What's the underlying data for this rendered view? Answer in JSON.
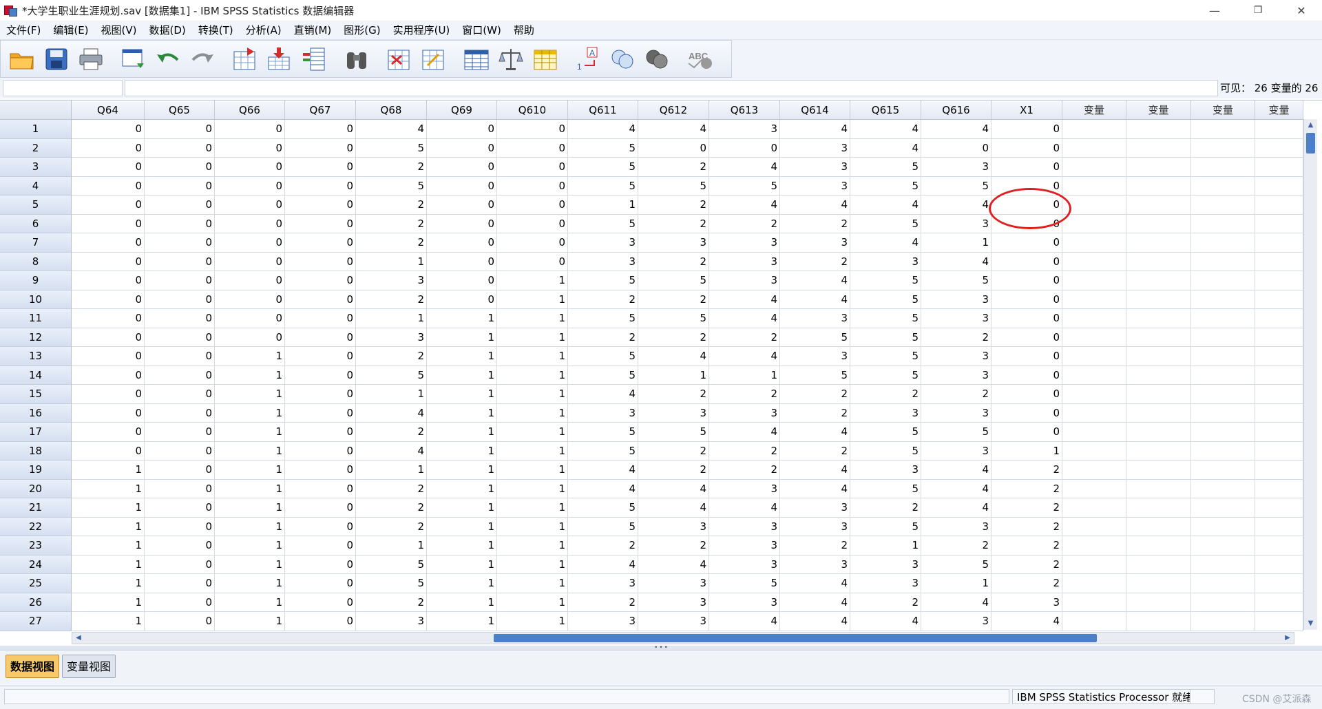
{
  "window": {
    "title": "*大学生职业生涯规划.sav [数据集1] - IBM SPSS Statistics 数据编辑器",
    "minimize": "—",
    "restore": "❐",
    "close": "✕"
  },
  "menu": [
    "文件(F)",
    "编辑(E)",
    "视图(V)",
    "数据(D)",
    "转换(T)",
    "分析(A)",
    "直销(M)",
    "图形(G)",
    "实用程序(U)",
    "窗口(W)",
    "帮助"
  ],
  "toolbar": {
    "icons": [
      "open-folder-icon",
      "save-icon",
      "print-icon",
      "dialog-recall-icon",
      "undo-icon",
      "redo-icon",
      "goto-case-icon",
      "goto-variable-icon",
      "variables-icon",
      "find-icon",
      "insert-cases-icon",
      "insert-variable-icon",
      "split-file-icon",
      "weight-cases-icon",
      "select-cases-icon",
      "value-labels-icon",
      "use-variable-sets-icon",
      "show-all-variables-icon",
      "spell-check-icon"
    ]
  },
  "cell_editor": {
    "reference": "",
    "value": "",
    "visible_vars": "可见： 26 变量的 26"
  },
  "grid": {
    "columns": [
      "Q64",
      "Q65",
      "Q66",
      "Q67",
      "Q68",
      "Q69",
      "Q610",
      "Q611",
      "Q612",
      "Q613",
      "Q614",
      "Q615",
      "Q616",
      "X1",
      "变量",
      "变量",
      "变量",
      "变量"
    ],
    "rows": [
      [
        "1",
        [
          0,
          0,
          0,
          0,
          4,
          0,
          0,
          4,
          4,
          3,
          4,
          4,
          4,
          0
        ]
      ],
      [
        "2",
        [
          0,
          0,
          0,
          0,
          5,
          0,
          0,
          5,
          0,
          0,
          3,
          4,
          0,
          0
        ]
      ],
      [
        "3",
        [
          0,
          0,
          0,
          0,
          2,
          0,
          0,
          5,
          2,
          4,
          3,
          5,
          3,
          0
        ]
      ],
      [
        "4",
        [
          0,
          0,
          0,
          0,
          5,
          0,
          0,
          5,
          5,
          5,
          3,
          5,
          5,
          0
        ]
      ],
      [
        "5",
        [
          0,
          0,
          0,
          0,
          2,
          0,
          0,
          1,
          2,
          4,
          4,
          4,
          4,
          0
        ]
      ],
      [
        "6",
        [
          0,
          0,
          0,
          0,
          2,
          0,
          0,
          5,
          2,
          2,
          2,
          5,
          3,
          0
        ]
      ],
      [
        "7",
        [
          0,
          0,
          0,
          0,
          2,
          0,
          0,
          3,
          3,
          3,
          3,
          4,
          1,
          0
        ]
      ],
      [
        "8",
        [
          0,
          0,
          0,
          0,
          1,
          0,
          0,
          3,
          2,
          3,
          2,
          3,
          4,
          0
        ]
      ],
      [
        "9",
        [
          0,
          0,
          0,
          0,
          3,
          0,
          1,
          5,
          5,
          3,
          4,
          5,
          5,
          0
        ]
      ],
      [
        "10",
        [
          0,
          0,
          0,
          0,
          2,
          0,
          1,
          2,
          2,
          4,
          4,
          5,
          3,
          0
        ]
      ],
      [
        "11",
        [
          0,
          0,
          0,
          0,
          1,
          1,
          1,
          5,
          5,
          4,
          3,
          5,
          3,
          0
        ]
      ],
      [
        "12",
        [
          0,
          0,
          0,
          0,
          3,
          1,
          1,
          2,
          2,
          2,
          5,
          5,
          2,
          0
        ]
      ],
      [
        "13",
        [
          0,
          0,
          1,
          0,
          2,
          1,
          1,
          5,
          4,
          4,
          3,
          5,
          3,
          0
        ]
      ],
      [
        "14",
        [
          0,
          0,
          1,
          0,
          5,
          1,
          1,
          5,
          1,
          1,
          5,
          5,
          3,
          0
        ]
      ],
      [
        "15",
        [
          0,
          0,
          1,
          0,
          1,
          1,
          1,
          4,
          2,
          2,
          2,
          2,
          2,
          0
        ]
      ],
      [
        "16",
        [
          0,
          0,
          1,
          0,
          4,
          1,
          1,
          3,
          3,
          3,
          2,
          3,
          3,
          0
        ]
      ],
      [
        "17",
        [
          0,
          0,
          1,
          0,
          2,
          1,
          1,
          5,
          5,
          4,
          4,
          5,
          5,
          0
        ]
      ],
      [
        "18",
        [
          0,
          0,
          1,
          0,
          4,
          1,
          1,
          5,
          2,
          2,
          2,
          5,
          3,
          1
        ]
      ],
      [
        "19",
        [
          1,
          0,
          1,
          0,
          1,
          1,
          1,
          4,
          2,
          2,
          4,
          3,
          4,
          2
        ]
      ],
      [
        "20",
        [
          1,
          0,
          1,
          0,
          2,
          1,
          1,
          4,
          4,
          3,
          4,
          5,
          4,
          2
        ]
      ],
      [
        "21",
        [
          1,
          0,
          1,
          0,
          2,
          1,
          1,
          5,
          4,
          4,
          3,
          2,
          4,
          2
        ]
      ],
      [
        "22",
        [
          1,
          0,
          1,
          0,
          2,
          1,
          1,
          5,
          3,
          3,
          3,
          5,
          3,
          2
        ]
      ],
      [
        "23",
        [
          1,
          0,
          1,
          0,
          1,
          1,
          1,
          2,
          2,
          3,
          2,
          1,
          2,
          2
        ]
      ],
      [
        "24",
        [
          1,
          0,
          1,
          0,
          5,
          1,
          1,
          4,
          4,
          3,
          3,
          3,
          5,
          2
        ]
      ],
      [
        "25",
        [
          1,
          0,
          1,
          0,
          5,
          1,
          1,
          3,
          3,
          5,
          4,
          3,
          1,
          2
        ]
      ],
      [
        "26",
        [
          1,
          0,
          1,
          0,
          2,
          1,
          1,
          2,
          3,
          3,
          4,
          2,
          4,
          3
        ]
      ],
      [
        "27",
        [
          1,
          0,
          1,
          0,
          3,
          1,
          1,
          3,
          3,
          4,
          4,
          4,
          3,
          4
        ]
      ]
    ]
  },
  "tabs": {
    "data_view": "数据视图",
    "variable_view": "变量视图"
  },
  "status": {
    "processor": "IBM SPSS Statistics Processor 就绪",
    "watermark": "CSDN @艾派森"
  },
  "colors": {
    "highlight": "#e02020",
    "active_tab": "#f7c96a",
    "scroll_thumb": "#4b7fc8"
  }
}
